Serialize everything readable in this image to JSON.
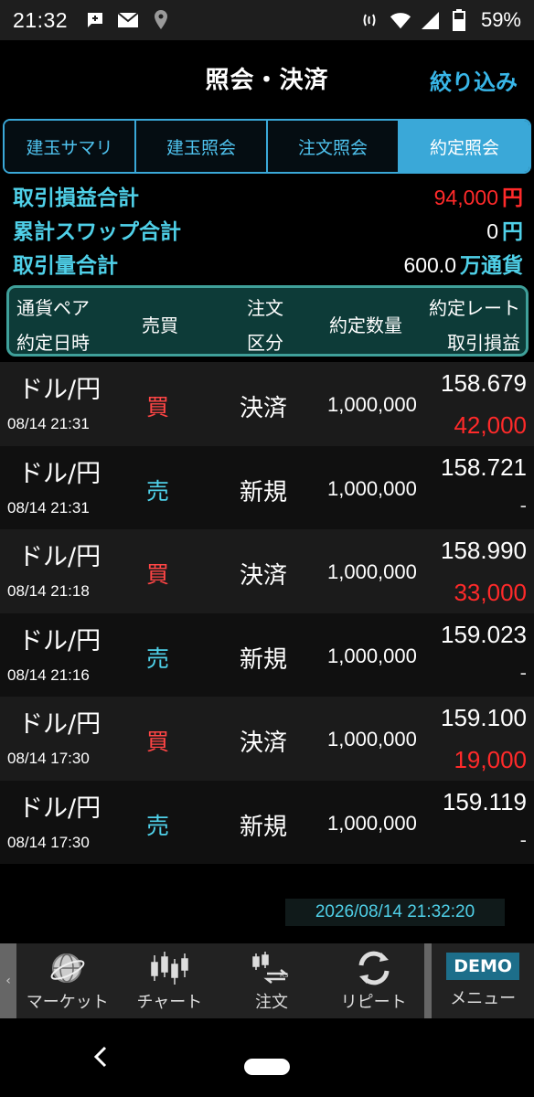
{
  "status_bar": {
    "time": "21:32",
    "battery": "59%"
  },
  "header": {
    "title": "照会・決済",
    "filter_label": "絞り込み"
  },
  "tabs": [
    {
      "label": "建玉サマリ",
      "active": false
    },
    {
      "label": "建玉照会",
      "active": false
    },
    {
      "label": "注文照会",
      "active": false
    },
    {
      "label": "約定照会",
      "active": true
    }
  ],
  "summary": {
    "pl_total": {
      "label": "取引損益合計",
      "value": "94,000",
      "unit": "円"
    },
    "swap_total": {
      "label": "累計スワップ合計",
      "value": "0",
      "unit": "円"
    },
    "volume_total": {
      "label": "取引量合計",
      "value": "600.0",
      "unit": "万通貨"
    }
  },
  "table_header": {
    "pair": "通貨ペア",
    "datetime": "約定日時",
    "side": "売買",
    "order_type_1": "注文",
    "order_type_2": "区分",
    "quantity": "約定数量",
    "rate": "約定レート",
    "pl": "取引損益"
  },
  "rows": [
    {
      "pair": "ドル/円",
      "datetime": "08/14 21:31",
      "side": "買",
      "side_type": "buy",
      "order_type": "決済",
      "quantity": "1,000,000",
      "rate": "158.679",
      "pl": "42,000"
    },
    {
      "pair": "ドル/円",
      "datetime": "08/14 21:31",
      "side": "売",
      "side_type": "sell",
      "order_type": "新規",
      "quantity": "1,000,000",
      "rate": "158.721",
      "pl": "-"
    },
    {
      "pair": "ドル/円",
      "datetime": "08/14 21:18",
      "side": "買",
      "side_type": "buy",
      "order_type": "決済",
      "quantity": "1,000,000",
      "rate": "158.990",
      "pl": "33,000"
    },
    {
      "pair": "ドル/円",
      "datetime": "08/14 21:16",
      "side": "売",
      "side_type": "sell",
      "order_type": "新規",
      "quantity": "1,000,000",
      "rate": "159.023",
      "pl": "-"
    },
    {
      "pair": "ドル/円",
      "datetime": "08/14 17:30",
      "side": "買",
      "side_type": "buy",
      "order_type": "決済",
      "quantity": "1,000,000",
      "rate": "159.100",
      "pl": "19,000"
    },
    {
      "pair": "ドル/円",
      "datetime": "08/14 17:30",
      "side": "売",
      "side_type": "sell",
      "order_type": "新規",
      "quantity": "1,000,000",
      "rate": "159.119",
      "pl": "-"
    }
  ],
  "timestamp": "2026/08/14 21:32:20",
  "bottom_nav": {
    "items": [
      {
        "label": "マーケット",
        "icon": "globe-icon"
      },
      {
        "label": "チャート",
        "icon": "candlestick-icon"
      },
      {
        "label": "注文",
        "icon": "order-icon"
      },
      {
        "label": "リピート",
        "icon": "repeat-icon"
      }
    ],
    "menu_badge": "DEMO",
    "menu_label": "メニュー"
  },
  "colors": {
    "accent": "#3aa8d8",
    "buy": "#ff4545",
    "sell": "#4fd0e8",
    "profit": "#ff2a2a",
    "table_header_bg": "#0d3b38"
  }
}
